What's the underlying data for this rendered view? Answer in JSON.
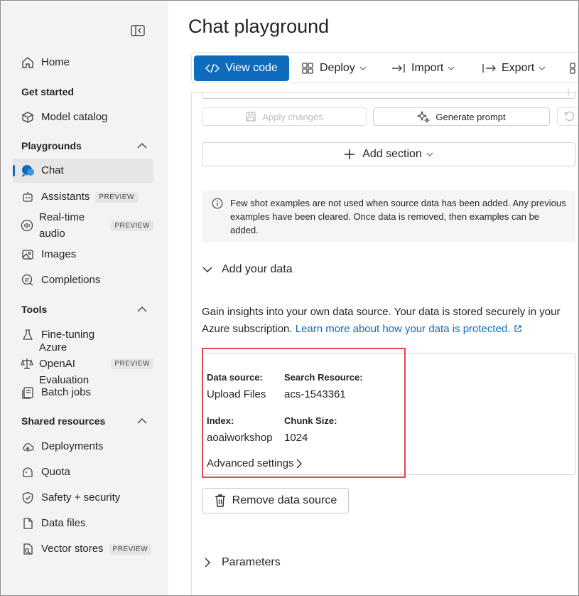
{
  "sidebar": {
    "collapse_icon": "panel-collapse-icon",
    "items": [
      {
        "label": "Home",
        "icon": "home-icon"
      },
      {
        "label": "Model catalog",
        "icon": "cube-icon"
      },
      {
        "label": "Chat",
        "icon": "chat-icon",
        "active": true
      },
      {
        "label": "Assistants",
        "icon": "bot-icon",
        "badge": "PREVIEW"
      },
      {
        "label": "Real-time audio",
        "icon": "audio-icon",
        "badge": "PREVIEW"
      },
      {
        "label": "Images",
        "icon": "image-icon"
      },
      {
        "label": "Completions",
        "icon": "completion-icon"
      },
      {
        "label": "Fine-tuning",
        "icon": "flask-icon"
      },
      {
        "label": "Azure OpenAI Evaluation",
        "icon": "scale-icon",
        "badge": "PREVIEW"
      },
      {
        "label": "Batch jobs",
        "icon": "batch-icon"
      },
      {
        "label": "Deployments",
        "icon": "cloud-icon"
      },
      {
        "label": "Quota",
        "icon": "quota-icon"
      },
      {
        "label": "Safety + security",
        "icon": "shield-icon"
      },
      {
        "label": "Data files",
        "icon": "file-icon"
      },
      {
        "label": "Vector stores",
        "icon": "vector-icon",
        "badge": "PREVIEW"
      }
    ],
    "sections": {
      "get_started": "Get started",
      "playgrounds": "Playgrounds",
      "tools": "Tools",
      "shared_resources": "Shared resources"
    }
  },
  "main": {
    "title": "Chat playground",
    "toolbar": {
      "view_code": "View code",
      "deploy": "Deploy",
      "import": "Import",
      "export": "Export"
    },
    "apply_changes": "Apply changes",
    "generate_prompt": "Generate prompt",
    "add_section": "Add section",
    "info_text": "Few shot examples are not used when source data has been added. Any previous examples have been cleared. Once data is removed, then examples can be added.",
    "add_your_data": "Add your data",
    "description": "Gain insights into your own data source. Your data is stored securely in your Azure subscription.",
    "learn_more": "Learn more about how your data is protected.",
    "data_card": {
      "data_source_label": "Data source:",
      "data_source_value": "Upload Files",
      "search_resource_label": "Search Resource:",
      "search_resource_value": "acs-1543361",
      "index_label": "Index:",
      "index_value": "aoaiworkshop",
      "chunk_size_label": "Chunk Size:",
      "chunk_size_value": "1024",
      "advanced_settings": "Advanced settings"
    },
    "remove_data_source": "Remove data source",
    "parameters": "Parameters"
  },
  "colors": {
    "accent": "#0f6cbd",
    "highlight": "#e0474e",
    "sidebar_bg": "#f3f3f3"
  }
}
